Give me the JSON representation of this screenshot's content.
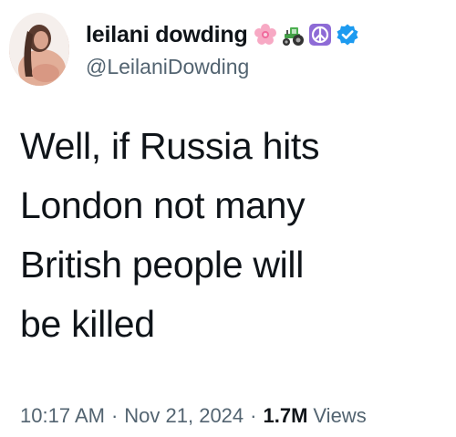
{
  "user": {
    "display_name": "leilani dowding",
    "handle": "@LeilaniDowding",
    "name_emojis": [
      "cherry-blossom-icon",
      "tractor-icon",
      "peace-symbol-icon"
    ],
    "verified_icon": "verified-badge-icon"
  },
  "tweet": {
    "lines": [
      "Well, if Russia hits",
      "London not many",
      "British people will",
      "be killed"
    ]
  },
  "meta": {
    "time": "10:17 AM",
    "separator": "·",
    "date": "Nov 21, 2024",
    "views_count": "1.7M",
    "views_label": "Views"
  },
  "colors": {
    "text": "#0f1419",
    "secondary": "#536471",
    "verified": "#1d9bf0",
    "peace_bg": "#8e6bd6"
  }
}
